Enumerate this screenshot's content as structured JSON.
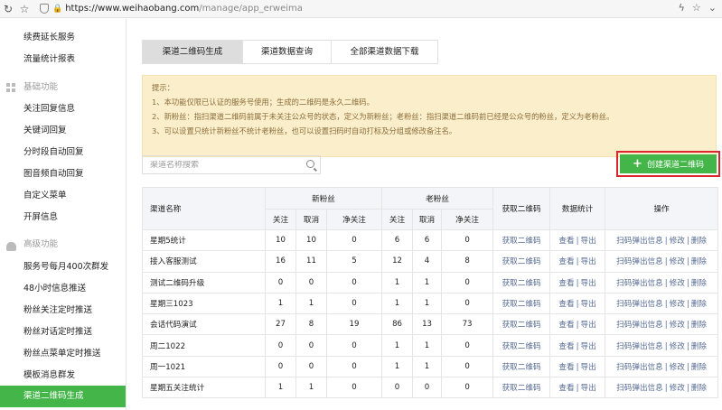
{
  "browser": {
    "url_main": "https://www.weihaobang.com",
    "url_path": "/manage/app_erweima",
    "lock_glyph": "🔒"
  },
  "sidebar": {
    "top_items": [
      "续费延长服务",
      "流量统计报表"
    ],
    "section_basic": "基础功能",
    "basic_items": [
      "关注回复信息",
      "关键词回复",
      "分时段自动回复",
      "图音频自动回复",
      "自定义菜单",
      "开屏信息"
    ],
    "section_advanced": "高级功能",
    "advanced_items": [
      "服务号每月400次群发",
      "48小时信息推送",
      "粉丝关注定时推送",
      "粉丝对话定时推送",
      "粉丝点菜单定时推送",
      "模板消息群发",
      "渠道二维码生成"
    ],
    "active_item": "渠道二维码生成"
  },
  "tabs": [
    {
      "label": "渠道二维码生成",
      "active": true
    },
    {
      "label": "渠道数据查询",
      "active": false
    },
    {
      "label": "全部渠道数据下载",
      "active": false
    }
  ],
  "notice": {
    "title": "提示：",
    "lines": [
      "1、本功能仅限已认证的服务号使用；生成的二维码是永久二维码。",
      "2、新粉丝：指扫渠道二维码前属于未关注公众号的状态，定义为新粉丝；老粉丝：指扫渠道二维码前已经是公众号的粉丝，定义为老粉丝。",
      "3、可以设置只统计新粉丝不统计老粉丝，也可以设置扫码时自动打标及分组或修改备注名。"
    ]
  },
  "search": {
    "placeholder": "渠道名称搜索"
  },
  "create_button": {
    "label": "创建渠道二维码"
  },
  "table": {
    "headers": {
      "name": "渠道名称",
      "new_fans": "新粉丝",
      "old_fans": "老粉丝",
      "follow": "关注",
      "cancel": "取消",
      "net": "净关注",
      "get_qr": "获取二维码",
      "stats": "数据统计",
      "ops": "操作"
    },
    "links": {
      "get_qr": "获取二维码",
      "view": "查看",
      "export": "导出",
      "popup": "扫码弹出信息",
      "edit": "修改",
      "delete": "删除"
    },
    "rows": [
      {
        "name": "星期5统计",
        "nf": [
          "10",
          "10",
          "0"
        ],
        "of": [
          "6",
          "6",
          "0"
        ]
      },
      {
        "name": "接入客服测试",
        "nf": [
          "16",
          "11",
          "5"
        ],
        "of": [
          "12",
          "4",
          "8"
        ]
      },
      {
        "name": "测试二维码升级",
        "nf": [
          "0",
          "0",
          "0"
        ],
        "of": [
          "1",
          "1",
          "0"
        ]
      },
      {
        "name": "星期三1023",
        "nf": [
          "1",
          "1",
          "0"
        ],
        "of": [
          "1",
          "1",
          "0"
        ]
      },
      {
        "name": "会话代码演试",
        "nf": [
          "27",
          "8",
          "19"
        ],
        "of": [
          "86",
          "13",
          "73"
        ]
      },
      {
        "name": "周二1022",
        "nf": [
          "0",
          "0",
          "0"
        ],
        "of": [
          "1",
          "1",
          "0"
        ]
      },
      {
        "name": "周一1021",
        "nf": [
          "0",
          "0",
          "0"
        ],
        "of": [
          "1",
          "1",
          "0"
        ]
      },
      {
        "name": "星期五关注统计",
        "nf": [
          "1",
          "1",
          "0"
        ],
        "of": [
          "0",
          "0",
          "0"
        ]
      }
    ]
  },
  "colors": {
    "accent": "#44b549",
    "link": "#576b95",
    "highlight": "#d9262c",
    "notice_bg": "#fbeeca"
  }
}
